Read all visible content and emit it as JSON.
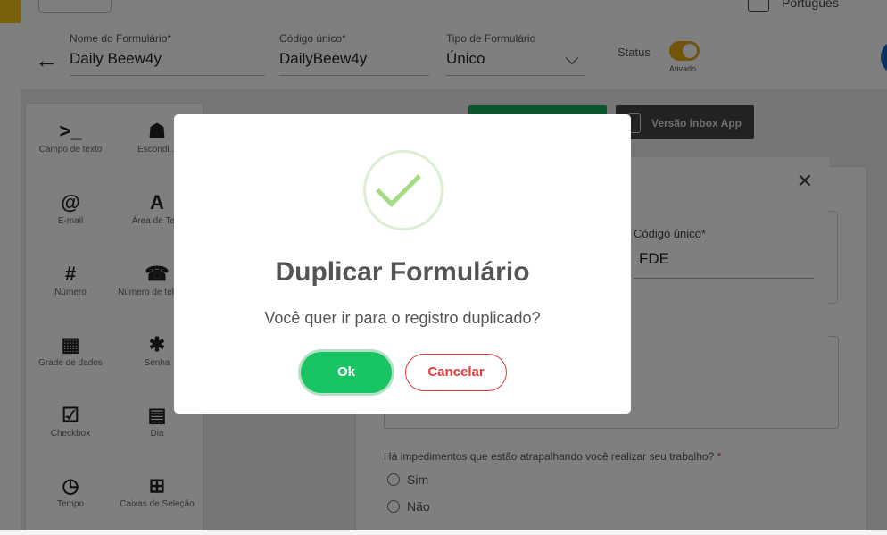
{
  "header": {
    "language": "Português",
    "form_name_label": "Nome do Formulário*",
    "form_name_value": "Daily Beew4y",
    "unique_code_label": "Código único*",
    "unique_code_value": "DailyBeew4y",
    "form_type_label": "Tipo de Formulário",
    "form_type_value": "Único",
    "status_label": "Status",
    "status_value": "Ativado",
    "status_on": true
  },
  "palette": [
    {
      "icon": "terminal-icon",
      "glyph": ">_",
      "label": "Campo de texto"
    },
    {
      "icon": "hidden-icon",
      "glyph": "☗",
      "label": "Escondi..."
    },
    {
      "icon": "at-icon",
      "glyph": "@",
      "label": "E-mail"
    },
    {
      "icon": "text-area-icon",
      "glyph": "A",
      "label": "Área de Te..."
    },
    {
      "icon": "hash-icon",
      "glyph": "#",
      "label": "Número"
    },
    {
      "icon": "phone-icon",
      "glyph": "☎",
      "label": "Número de telefone"
    },
    {
      "icon": "grid-icon",
      "glyph": "▦",
      "label": "Grade de dados"
    },
    {
      "icon": "asterisk-icon",
      "glyph": "✱",
      "label": "Senha"
    },
    {
      "icon": "checkbox-icon",
      "glyph": "☑",
      "label": "Checkbox"
    },
    {
      "icon": "calendar-icon",
      "glyph": "▤",
      "label": "Dia"
    },
    {
      "icon": "clock-icon",
      "glyph": "◷",
      "label": "Tempo"
    },
    {
      "icon": "plus-box-icon",
      "glyph": "⊞",
      "label": "Caixas de Seleção"
    }
  ],
  "toolbar": {
    "inbox_app_label": "Versão Inbox App"
  },
  "form": {
    "question": "Há impedimentos que estão atrapalhando você realizar seu trabalho?",
    "required_mark": "*",
    "options": [
      "Sim",
      "Não"
    ]
  },
  "back_dialog": {
    "close": "✕",
    "code_label": "Código único*",
    "code_value": "FDE"
  },
  "alert": {
    "title": "Duplicar Formulário",
    "text": "Você quer ir para o registro duplicado?",
    "ok_label": "Ok",
    "cancel_label": "Cancelar",
    "ok_color": "#19c463",
    "cancel_color": "#e53935"
  }
}
